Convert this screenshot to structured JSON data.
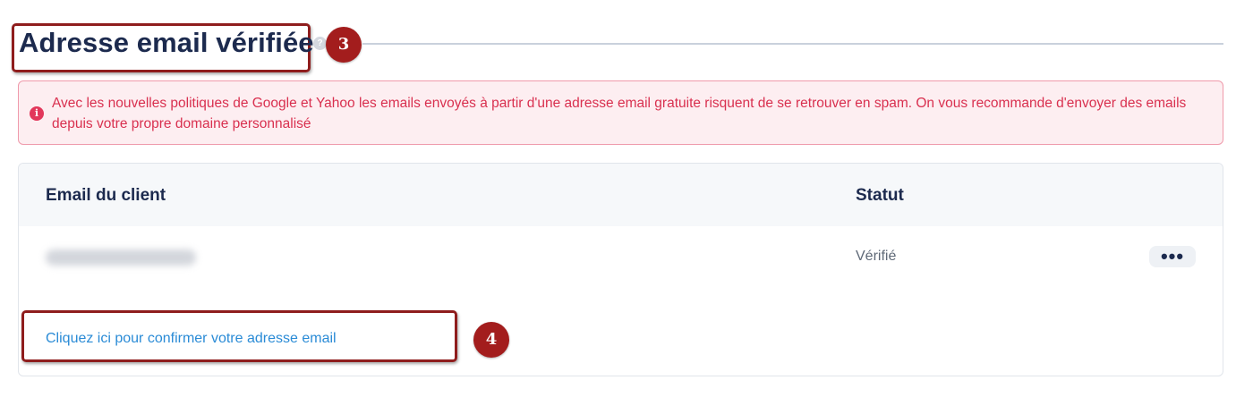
{
  "header": {
    "title": "Adresse email vérifiée",
    "help_icon": "help-circle-icon",
    "step_badge": "3"
  },
  "alert": {
    "icon": "info-circle-icon",
    "text": "Avec les nouvelles politiques de Google et Yahoo les emails envoyés à partir d'une adresse email gratuite risquent de se retrouver en spam. On vous recommande d'envoyer des emails depuis votre propre domaine personnalisé"
  },
  "table": {
    "columns": [
      "Email du client",
      "Statut"
    ],
    "rows": [
      {
        "status": "Vérifié",
        "actions_icon": "more-horizontal-icon"
      }
    ]
  },
  "confirm": {
    "link_label": "Cliquez ici pour confirmer votre adresse email",
    "step_badge": "4"
  },
  "colors": {
    "title": "#1c2a4e",
    "annotation": "#a31d1d",
    "alert_text": "#d9304f",
    "alert_bg": "#fdeef1",
    "link": "#2a8bd6"
  }
}
